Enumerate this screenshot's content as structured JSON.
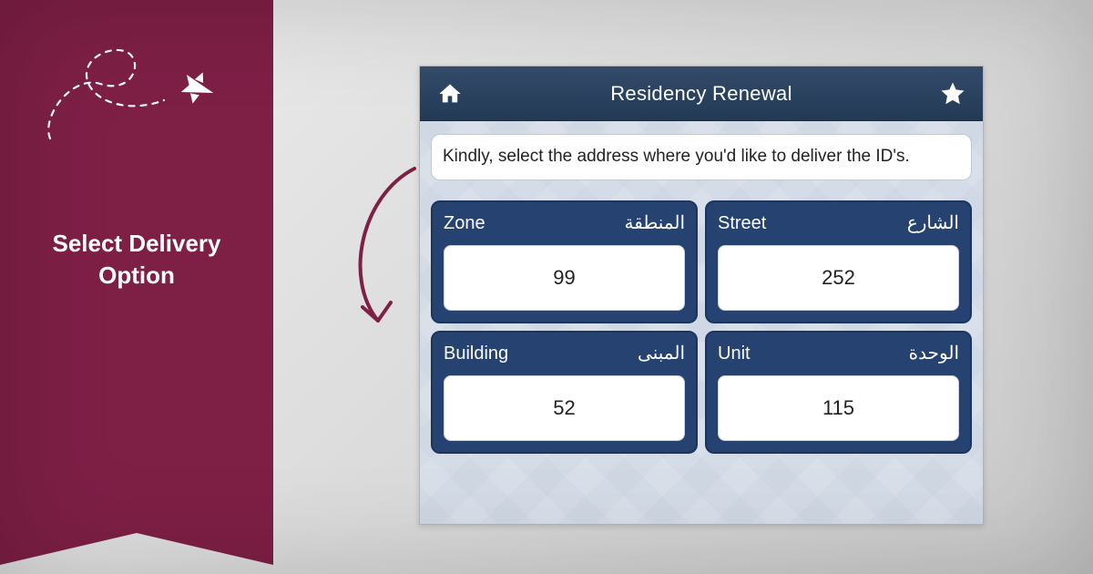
{
  "colors": {
    "maroon": "#7e1f46",
    "navy": "#254271",
    "navy_dark": "#233a55"
  },
  "side": {
    "heading": "Select Delivery Option"
  },
  "arrow": {
    "stroke": "#7e1f46"
  },
  "app": {
    "titlebar": {
      "title": "Residency Renewal",
      "home_icon": "home-icon",
      "star_icon": "star-icon"
    },
    "instruction": "Kindly, select the address where you'd like to deliver the ID's.",
    "fields": [
      {
        "id": "zone",
        "label_en": "Zone",
        "label_ar": "المنطقة",
        "value": "99"
      },
      {
        "id": "street",
        "label_en": "Street",
        "label_ar": "الشارع",
        "value": "252"
      },
      {
        "id": "building",
        "label_en": "Building",
        "label_ar": "المبنى",
        "value": "52"
      },
      {
        "id": "unit",
        "label_en": "Unit",
        "label_ar": "الوحدة",
        "value": "115"
      }
    ]
  }
}
